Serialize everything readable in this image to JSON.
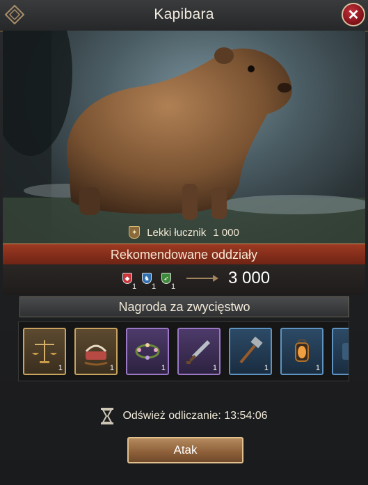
{
  "window": {
    "title": "Kapibara"
  },
  "enemy": {
    "unit_type": "Lekki łucznik",
    "count": "1 000"
  },
  "recommended": {
    "title": "Rekomendowane oddziały",
    "troops": [
      {
        "icon": "red-shield-icon",
        "count": "1",
        "color": "#c8343a"
      },
      {
        "icon": "blue-horse-icon",
        "count": "1",
        "color": "#2f6fb0"
      },
      {
        "icon": "green-bow-icon",
        "count": "1",
        "color": "#3f8a3a"
      }
    ],
    "power": "3 000"
  },
  "reward": {
    "title": "Nagroda za zwycięstwo",
    "items": [
      {
        "icon": "scales-icon",
        "qty": "1",
        "rarity": "gold"
      },
      {
        "icon": "cradle-icon",
        "qty": "1",
        "rarity": "gold"
      },
      {
        "icon": "flower-wreath-icon",
        "qty": "1",
        "rarity": "purple"
      },
      {
        "icon": "dagger-icon",
        "qty": "1",
        "rarity": "purple"
      },
      {
        "icon": "hammer-icon",
        "qty": "1",
        "rarity": "blue"
      },
      {
        "icon": "lantern-icon",
        "qty": "1",
        "rarity": "blue"
      },
      {
        "icon": "partial-item-icon",
        "qty": "",
        "rarity": "blue"
      }
    ]
  },
  "refresh": {
    "label": "Odśwież odliczanie: 13:54:06"
  },
  "attack": {
    "label": "Atak"
  }
}
